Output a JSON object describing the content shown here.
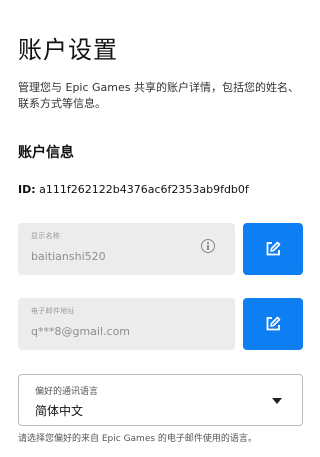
{
  "header": {
    "title": "账户设置",
    "description": "管理您与 Epic Games 共享的账户详情，包括您的姓名、联系方式等信息。"
  },
  "account_info": {
    "section_title": "账户信息",
    "id_label": "ID:",
    "id_value": "a111f262122b4376ac6f2353ab9fdb0f"
  },
  "display_name": {
    "label": "显示名称",
    "value": "baitianshi520",
    "info_icon": "info-icon",
    "edit_icon": "edit-icon"
  },
  "email": {
    "label": "电子邮件地址",
    "value": "q***8@gmail.com",
    "edit_icon": "edit-icon"
  },
  "language": {
    "label": "偏好的通讯语言",
    "selected": "简体中文",
    "helper": "请选择您偏好的来自 Epic Games 的电子邮件使用的语言。"
  },
  "colors": {
    "accent": "#0d7ff2",
    "field_background": "#ececec"
  }
}
